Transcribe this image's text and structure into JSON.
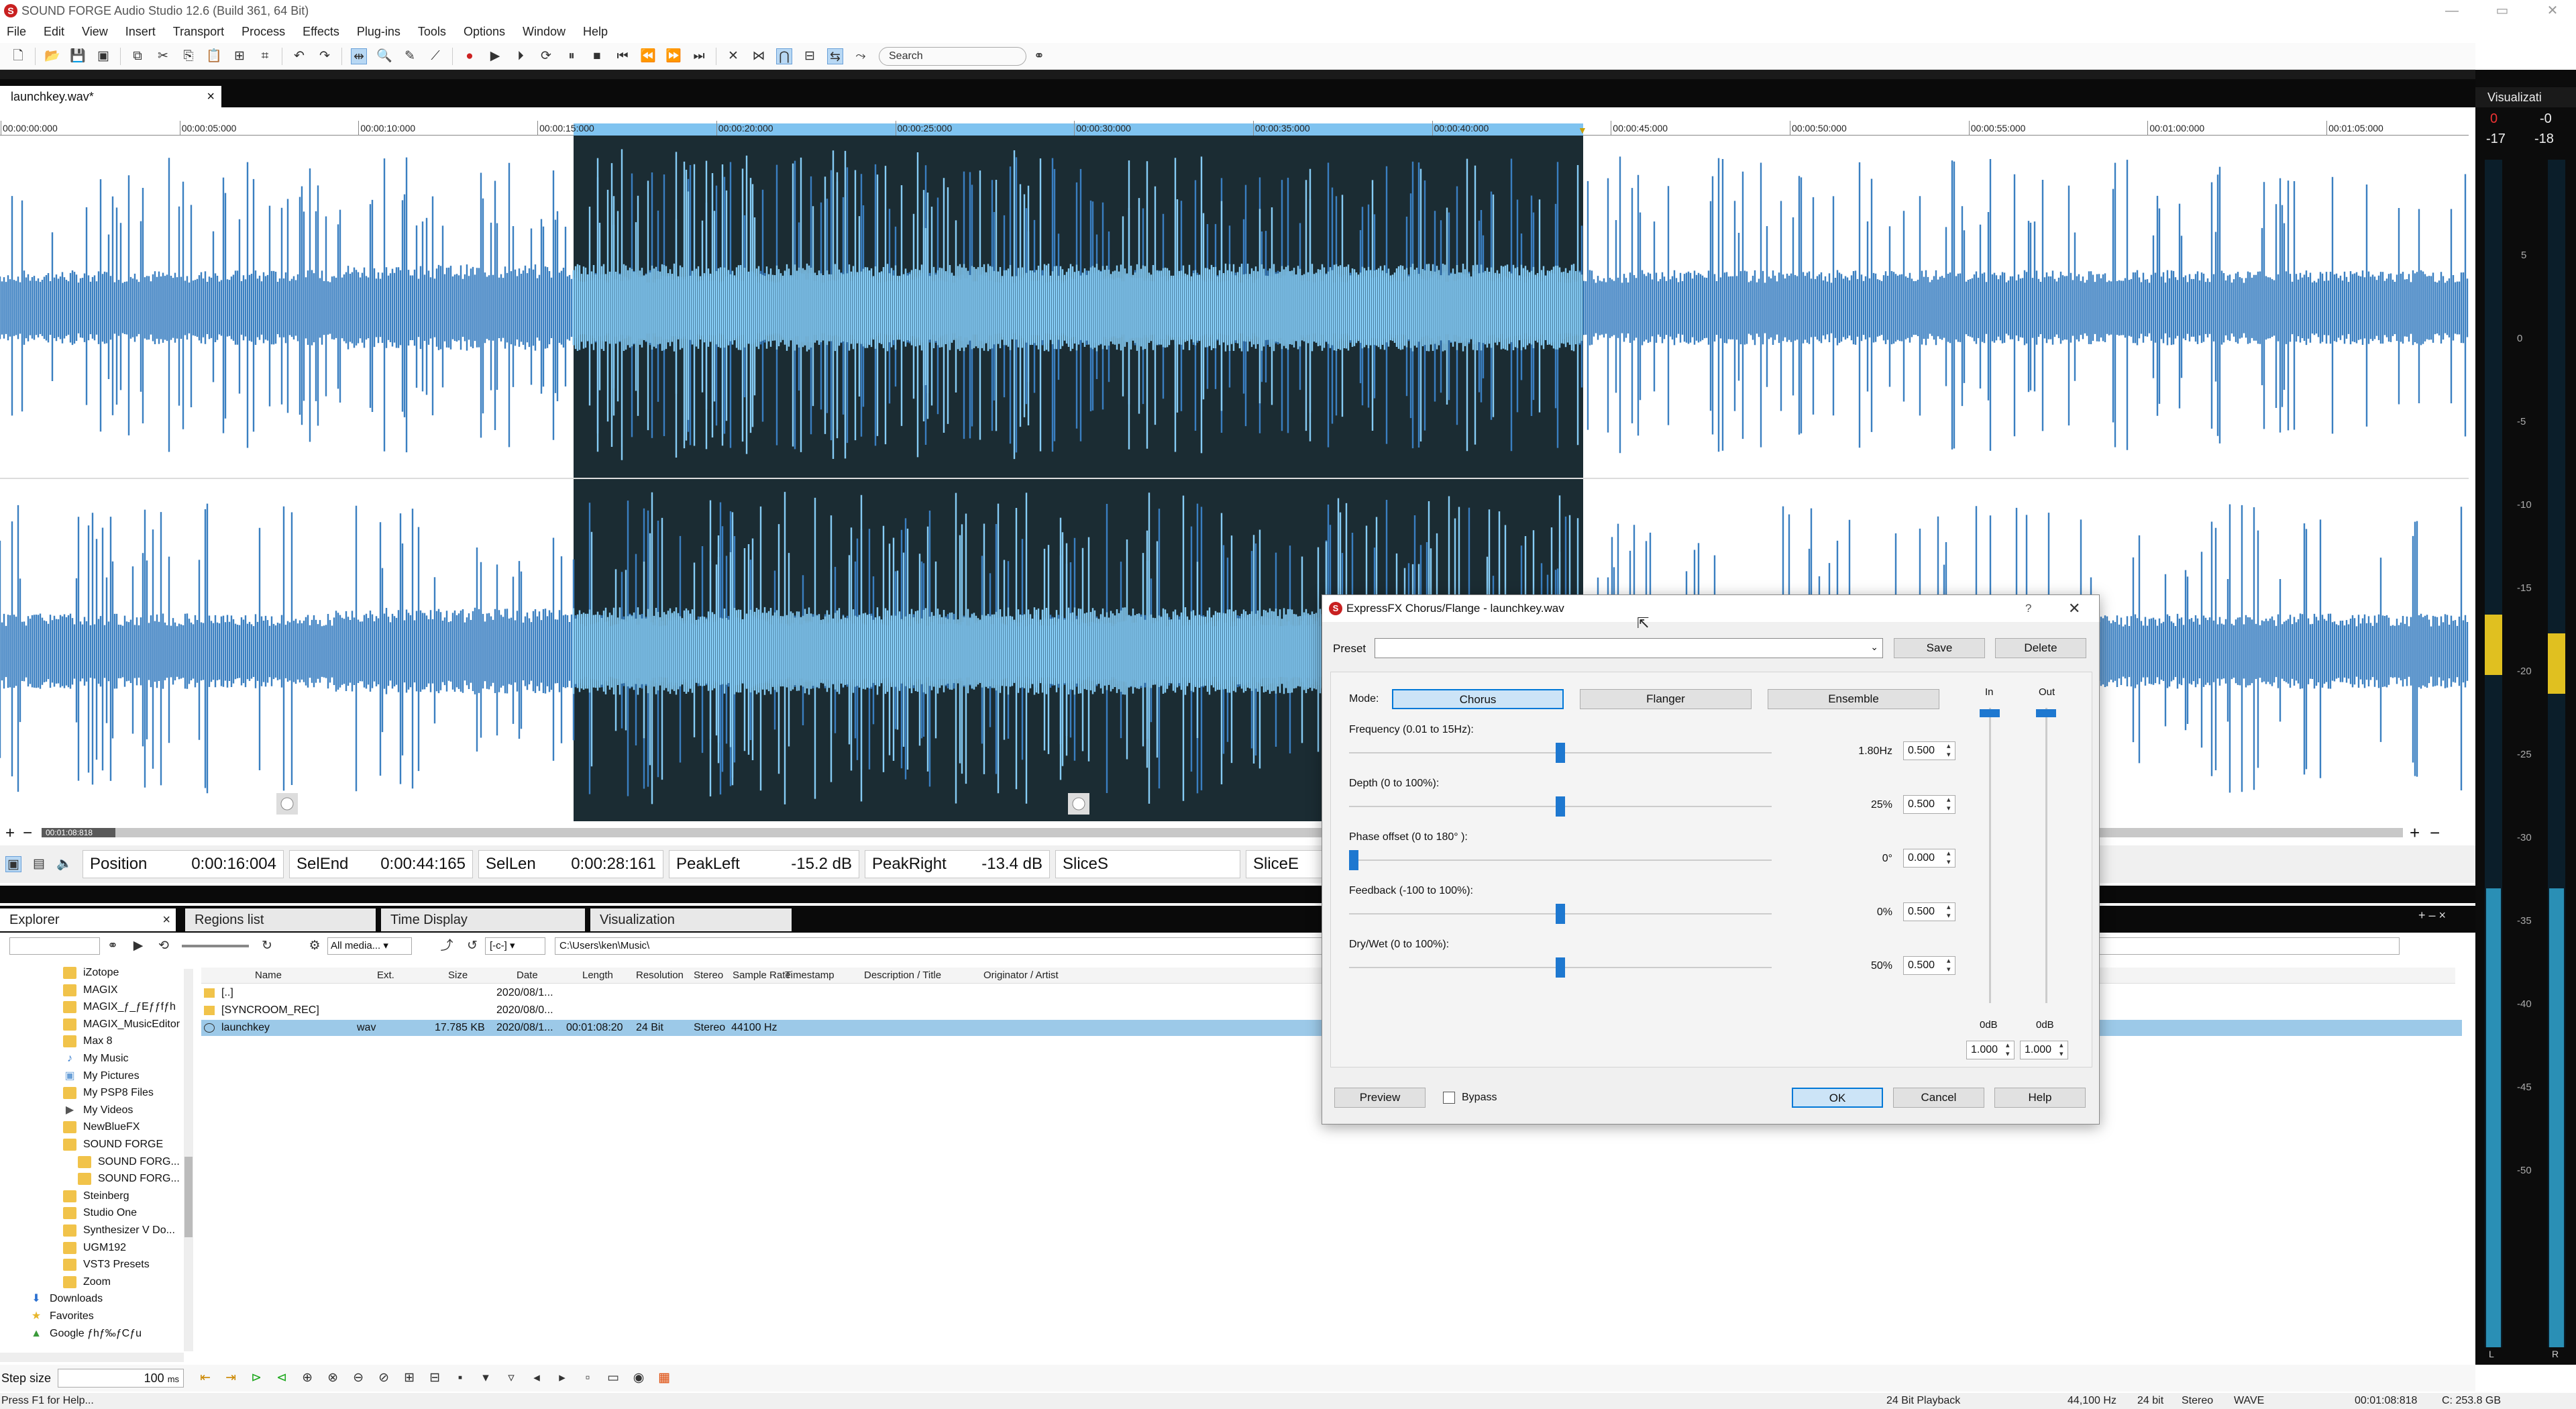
{
  "app": {
    "title": "SOUND FORGE Audio Studio 12.6 (Build 361, 64 Bit)"
  },
  "menu": [
    "File",
    "Edit",
    "View",
    "Insert",
    "Transport",
    "Process",
    "Effects",
    "Plug-ins",
    "Tools",
    "Options",
    "Window",
    "Help"
  ],
  "toolbar": {
    "search_placeholder": "Search"
  },
  "document": {
    "tab": "launchkey.wav*"
  },
  "ruler": [
    "00:00:00:000",
    "00:00:05:000",
    "00:00:10:000",
    "00:00:15:000",
    "00:00:20:000",
    "00:00:25:000",
    "00:00:30:000",
    "00:00:35:000",
    "00:00:40:000",
    "00:00:45:000",
    "00:00:50:000",
    "00:00:55:000",
    "00:01:00:000",
    "00:01:05:000"
  ],
  "wave": {
    "length": "00:01:08:818"
  },
  "status_fields": [
    {
      "label": "Position",
      "value": "0:00:16:004"
    },
    {
      "label": "SelEnd",
      "value": "0:00:44:165"
    },
    {
      "label": "SelLen",
      "value": "0:00:28:161"
    },
    {
      "label": "PeakLeft",
      "value": "-15.2 dB"
    },
    {
      "label": "PeakRight",
      "value": "-13.4 dB"
    },
    {
      "label": "SliceS",
      "value": ""
    },
    {
      "label": "SliceE",
      "value": ""
    }
  ],
  "lower_tabs": [
    "Explorer",
    "Regions list",
    "Time Display",
    "Visualization"
  ],
  "explorer": {
    "filter": "All media...",
    "drive": "[-c-]",
    "path": "C:\\Users\\ken\\Music\\",
    "tree": [
      {
        "label": "iZotope",
        "indent": 1,
        "icon": "folder"
      },
      {
        "label": "MAGIX",
        "indent": 1,
        "icon": "folder"
      },
      {
        "label": "MAGIX_ƒ_ƒEƒƒfƒh",
        "indent": 1,
        "icon": "folder"
      },
      {
        "label": "MAGIX_MusicEditor",
        "indent": 1,
        "icon": "folder"
      },
      {
        "label": "Max 8",
        "indent": 1,
        "icon": "folder"
      },
      {
        "label": "My Music",
        "indent": 1,
        "icon": "music"
      },
      {
        "label": "My Pictures",
        "indent": 1,
        "icon": "pictures"
      },
      {
        "label": "My PSP8 Files",
        "indent": 1,
        "icon": "folder"
      },
      {
        "label": "My Videos",
        "indent": 1,
        "icon": "videos"
      },
      {
        "label": "NewBlueFX",
        "indent": 1,
        "icon": "folder"
      },
      {
        "label": "SOUND FORGE",
        "indent": 1,
        "icon": "folder"
      },
      {
        "label": "SOUND FORG...",
        "indent": 2,
        "icon": "folder"
      },
      {
        "label": "SOUND FORG...",
        "indent": 2,
        "icon": "folder"
      },
      {
        "label": "Steinberg",
        "indent": 1,
        "icon": "folder"
      },
      {
        "label": "Studio One",
        "indent": 1,
        "icon": "folder"
      },
      {
        "label": "Synthesizer V Do...",
        "indent": 1,
        "icon": "folder"
      },
      {
        "label": "UGM192",
        "indent": 1,
        "icon": "folder"
      },
      {
        "label": "VST3 Presets",
        "indent": 1,
        "icon": "folder"
      },
      {
        "label": "Zoom",
        "indent": 1,
        "icon": "folder"
      },
      {
        "label": "Downloads",
        "indent": 0,
        "icon": "download"
      },
      {
        "label": "Favorites",
        "indent": 0,
        "icon": "star"
      },
      {
        "label": "Google ƒhƒ‰ƒCƒu",
        "indent": 0,
        "icon": "google"
      }
    ],
    "columns": [
      "Name",
      "Ext.",
      "Size",
      "Date",
      "Length",
      "Resolution",
      "Stereo",
      "Sample Rate",
      "Timestamp",
      "Description / Title",
      "Originator / Artist"
    ],
    "files": [
      {
        "name": "[..]",
        "ext": "",
        "size": "",
        "date": "2020/08/1...",
        "length": "",
        "resolution": "",
        "stereo": "",
        "rate": ""
      },
      {
        "name": "[SYNCROOM_REC]",
        "ext": "",
        "size": "",
        "date": "2020/08/0...",
        "length": "",
        "resolution": "",
        "stereo": "",
        "rate": ""
      },
      {
        "name": "launchkey",
        "ext": "wav",
        "size": "17.785 KB",
        "date": "2020/08/1...",
        "length": "00:01:08:20",
        "resolution": "24 Bit",
        "stereo": "Stereo",
        "rate": "44100 Hz"
      }
    ]
  },
  "bottom": {
    "step_label": "Step size",
    "step_value": "100",
    "step_unit": "ms"
  },
  "statusbar": {
    "help": "Press F1 for Help...",
    "playback": "24 Bit Playback",
    "rate": "44,100 Hz",
    "bits": "24 bit",
    "channels": "Stereo",
    "format": "WAVE",
    "length": "00:01:08:818",
    "disk": "C: 253.8 GB"
  },
  "viz": {
    "title": "Visualizati",
    "peak_l": "0",
    "peak_r": "-0",
    "lvl_l": "-17",
    "lvl_r": "-18",
    "scale": [
      "5",
      "0",
      "-5",
      "-10",
      "-15",
      "-20",
      "-25",
      "-30",
      "-35",
      "-40",
      "-45",
      "-50"
    ],
    "ch_l": "L",
    "ch_r": "R"
  },
  "dialog": {
    "title": "ExpressFX Chorus/Flange - launchkey.wav",
    "preset_label": "Preset",
    "save": "Save",
    "delete": "Delete",
    "mode_label": "Mode:",
    "modes": [
      "Chorus",
      "Flanger",
      "Ensemble"
    ],
    "params": [
      {
        "label": "Frequency (0.01 to 15Hz):",
        "value": "1.80Hz",
        "spin": "0.500",
        "pos": 0.5
      },
      {
        "label": "Depth (0 to 100%):",
        "value": "25%",
        "spin": "0.500",
        "pos": 0.5
      },
      {
        "label": "Phase offset (0 to 180° ):",
        "value": "0°",
        "spin": "0.000",
        "pos": 0.0
      },
      {
        "label": "Feedback (-100 to 100%):",
        "value": "0%",
        "spin": "0.500",
        "pos": 0.5
      },
      {
        "label": "Dry/Wet (0 to 100%):",
        "value": "50%",
        "spin": "0.500",
        "pos": 0.5
      }
    ],
    "in_label": "In",
    "out_label": "Out",
    "in_db": "0dB",
    "out_db": "0dB",
    "in_spin": "1.000",
    "out_spin": "1.000",
    "preview": "Preview",
    "bypass": "Bypass",
    "ok": "OK",
    "cancel": "Cancel",
    "help": "Help"
  },
  "colors": {
    "wave": "#3a7fc1",
    "wave_selected": "#86ccf5",
    "selection_bg": "#1b2c33",
    "accent": "#1e78d0"
  }
}
